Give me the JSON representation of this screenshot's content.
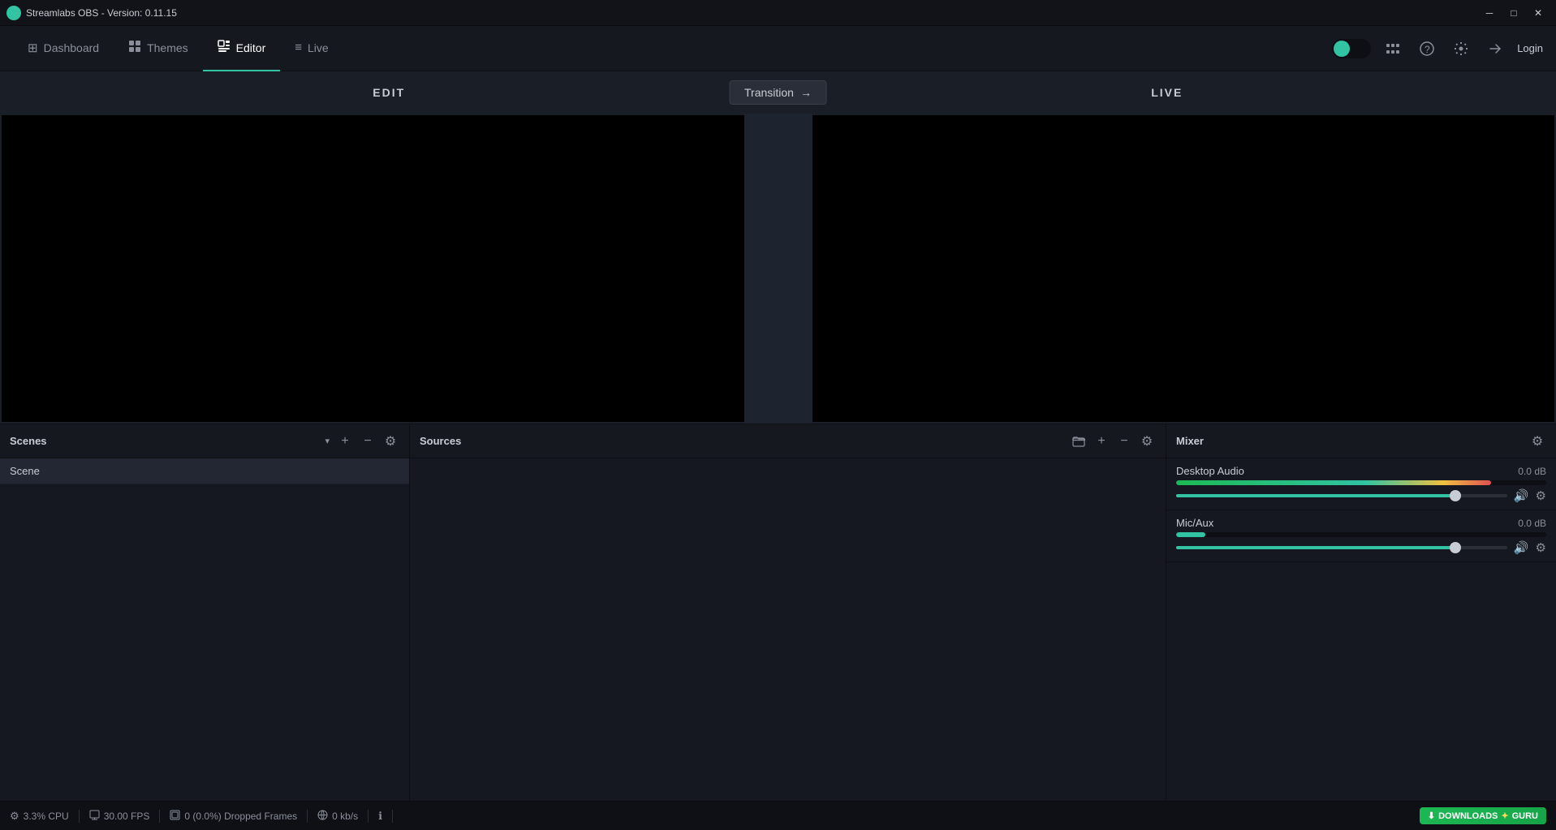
{
  "titlebar": {
    "app_icon": "●",
    "title": "Streamlabs OBS - Version: 0.11.15",
    "btn_minimize": "─",
    "btn_maximize": "□",
    "btn_close": "✕"
  },
  "topnav": {
    "items": [
      {
        "id": "dashboard",
        "icon": "⊞",
        "label": "Dashboard",
        "active": false
      },
      {
        "id": "themes",
        "icon": "◈",
        "label": "Themes",
        "active": false
      },
      {
        "id": "editor",
        "icon": "▦",
        "label": "Editor",
        "active": true
      },
      {
        "id": "live",
        "icon": "≡",
        "label": "Live",
        "active": false
      }
    ],
    "right": {
      "login_label": "Login",
      "settings_icon": "⚙",
      "help_icon": "?",
      "bars_icon": "≡",
      "login_icon": "→"
    }
  },
  "editor": {
    "edit_label": "EDIT",
    "live_label": "LIVE",
    "transition_label": "Transition",
    "transition_arrow": "→"
  },
  "scenes_panel": {
    "title": "Scenes",
    "add_icon": "+",
    "remove_icon": "−",
    "settings_icon": "⚙",
    "dropdown_icon": "▾",
    "items": [
      {
        "name": "Scene"
      }
    ]
  },
  "sources_panel": {
    "title": "Sources",
    "folder_icon": "⊟",
    "add_icon": "+",
    "remove_icon": "−",
    "settings_icon": "⚙",
    "items": []
  },
  "mixer_panel": {
    "title": "Mixer",
    "settings_icon": "⚙",
    "channels": [
      {
        "id": "desktop-audio",
        "name": "Desktop Audio",
        "db": "0.0 dB",
        "volume_pct": 85,
        "meter_pct": 85
      },
      {
        "id": "mic-aux",
        "name": "Mic/Aux",
        "db": "0.0 dB",
        "volume_pct": 85,
        "meter_pct": 8
      }
    ]
  },
  "statusbar": {
    "cpu_icon": "⚙",
    "cpu_label": "3.3% CPU",
    "fps_icon": "⬜",
    "fps_label": "30.00 FPS",
    "frames_icon": "⊡",
    "frames_label": "0 (0.0%) Dropped Frames",
    "network_icon": "⊙",
    "network_label": "0 kb/s",
    "info_icon": "ℹ",
    "downloads_label": "DOWNLOADS",
    "downloads_sub": "GURU"
  }
}
